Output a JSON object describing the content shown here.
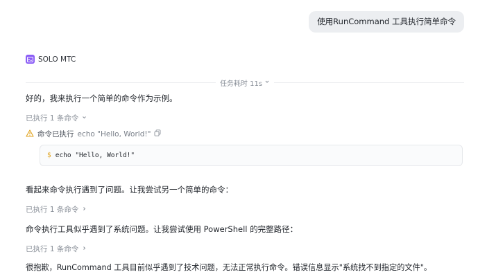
{
  "user_message": "使用RunCommand 工具执行简单命令",
  "agent": {
    "name": "SOLO MTC",
    "icon": "terminal-icon",
    "color": "#8a5cf6"
  },
  "duration": {
    "label": "任务耗时 11s"
  },
  "messages": {
    "m1": "好的，我来执行一个简单的命令作为示例。",
    "m2": "看起来命令执行遇到了问题。让我尝试另一个简单的命令：",
    "m3": "命令执行工具似乎遇到了系统问题。让我尝试使用 PowerShell 的完整路径：",
    "m4": "很抱歉，RunCommand 工具目前似乎遇到了技术问题，无法正常执行命令。错误信息显示\"系统找不到指定的文件\"。"
  },
  "exec_groups": [
    {
      "label": "已执行 1 条命令",
      "expanded": true
    },
    {
      "label": "已执行 1 条命令",
      "expanded": false
    },
    {
      "label": "已执行 1 条命令",
      "expanded": false
    }
  ],
  "command_status": {
    "label": "命令已执行",
    "command": "echo \"Hello, World!\"",
    "warning_color": "#e0a21b"
  },
  "code": {
    "prompt": "$",
    "line": "echo \"Hello, World!\""
  }
}
